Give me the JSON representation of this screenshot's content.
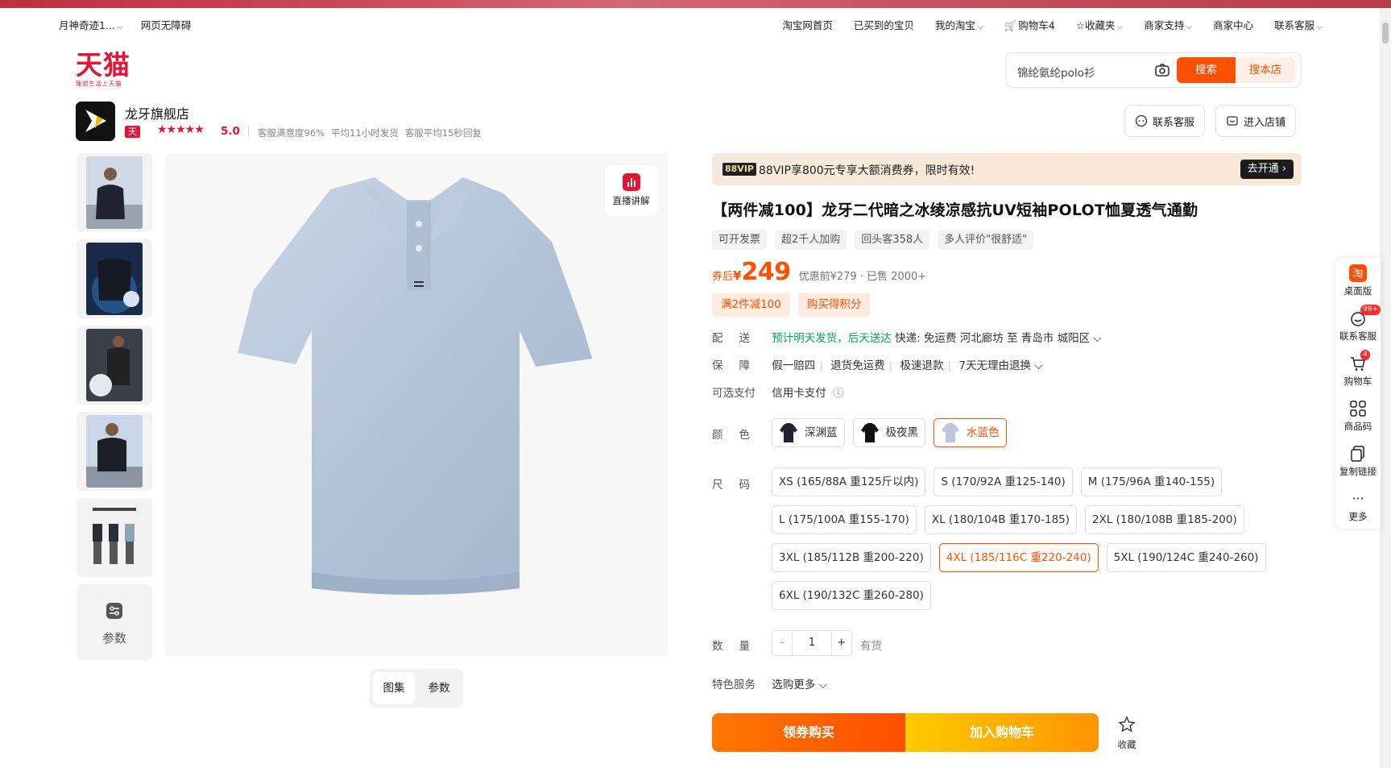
{
  "topbar": {
    "left": [
      "月神奇迹1...",
      "网页无障碍"
    ],
    "right": [
      "淘宝网首页",
      "已买到的宝贝",
      "我的淘宝",
      "购物车4",
      "收藏夹",
      "商家支持",
      "商家中心",
      "联系客服"
    ]
  },
  "logo": {
    "main": "天猫",
    "sub": "理想生活上天猫"
  },
  "search": {
    "query": "锦纶氨纶polo衫",
    "search_btn": "搜索",
    "shop_btn": "搜本店"
  },
  "shop": {
    "name": "龙牙旗舰店",
    "badge": "天猫",
    "stars": "★★★★★",
    "score": "5.0",
    "meta": [
      "客服满意度96%",
      "平均11小时发货",
      "客服平均15秒回复"
    ],
    "contact_btn": "联系客服",
    "enter_btn": "进入店铺"
  },
  "gallery": {
    "params_label": "参数",
    "live_label": "直播讲解",
    "tabs": [
      "图集",
      "参数"
    ]
  },
  "vip": {
    "tag": "88VIP",
    "text": "88VIP享800元专享大额消费券，限时有效!",
    "cta": "去开通 ›"
  },
  "product": {
    "title": "【两件减100】龙牙二代暗之冰绫凉感抗UV短袖POLOT恤夏透气通勤",
    "tags": [
      "可开发票",
      "超2千人加购",
      "回头客358人",
      "多人评价\"很舒适\""
    ],
    "price_prefix": "券后",
    "price_yen": "¥",
    "price": "249",
    "price_info": "优惠前¥279 · 已售 2000+",
    "promos": [
      "满2件减100",
      "购买得积分"
    ]
  },
  "delivery": {
    "label": "配送",
    "eta": "预计明天发货，后天送达",
    "detail": "快递: 免运费  河北廊坊  至  青岛市 城阳区"
  },
  "guarantee": {
    "label": "保障",
    "items": [
      "假一赔四",
      "退货免运费",
      "极速退款",
      "7天无理由退换"
    ]
  },
  "payment": {
    "label": "可选支付",
    "value": "信用卡支付"
  },
  "color": {
    "label": "颜色",
    "options": [
      {
        "name": "深渊蓝",
        "swatch": "#1d2330"
      },
      {
        "name": "极夜黑",
        "swatch": "#111111"
      },
      {
        "name": "水蓝色",
        "swatch": "#b9c8dc"
      }
    ],
    "selected": "水蓝色"
  },
  "size": {
    "label": "尺码",
    "rows": [
      [
        "XS (165/88A 重125斤以内)",
        "S (170/92A 重125-140)",
        "M (175/96A 重140-155)"
      ],
      [
        "L (175/100A 重155-170)",
        "XL (180/104B 重170-185)",
        "2XL (180/108B 重185-200)"
      ],
      [
        "3XL (185/112B 重200-220)",
        "4XL (185/116C 重220-240)",
        "5XL (190/124C 重240-260)"
      ],
      [
        "6XL (190/132C 重260-280)"
      ]
    ],
    "selected": "4XL (185/116C 重220-240)"
  },
  "quantity": {
    "label": "数量",
    "minus": "-",
    "value": "1",
    "plus": "+",
    "stock": "有货"
  },
  "service": {
    "label": "特色服务",
    "value": "选购更多"
  },
  "actions": {
    "buy": "领券购买",
    "cart": "加入购物车",
    "fav": "收藏"
  },
  "sidebar": [
    {
      "label": "桌面版",
      "icon": "taobao-icon"
    },
    {
      "label": "联系客服",
      "icon": "service-icon",
      "badge": "99+"
    },
    {
      "label": "购物车",
      "icon": "cart-icon",
      "badge": "4"
    },
    {
      "label": "商品码",
      "icon": "qrcode-icon"
    },
    {
      "label": "复制链接",
      "icon": "copy-icon"
    },
    {
      "label": "更多",
      "icon": "more-icon"
    }
  ],
  "colors": {
    "accent": "#ff5000",
    "brand": "#e31436",
    "green": "#06a856"
  }
}
